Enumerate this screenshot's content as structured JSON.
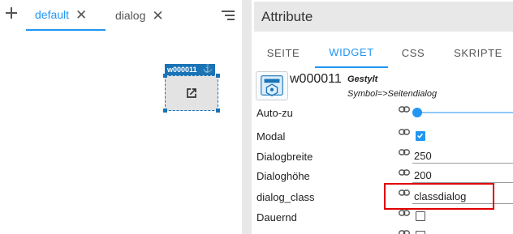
{
  "editor": {
    "tabs": [
      {
        "label": "default"
      },
      {
        "label": "dialog"
      }
    ],
    "widget": {
      "id_label": "w000011"
    }
  },
  "panel": {
    "title": "Attribute",
    "tabs": [
      {
        "label": "SEITE"
      },
      {
        "label": "WIDGET"
      },
      {
        "label": "CSS"
      },
      {
        "label": "SKRIPTE"
      }
    ],
    "active_tab": "WIDGET",
    "widget_id": "w000011",
    "styled": "Gestylt",
    "symbol": "Symbol=>Seitendialog",
    "rows": [
      {
        "label": "Auto-zu",
        "slider_level": 0
      },
      {
        "label": "Modal",
        "checked": true
      },
      {
        "label": "Dialogbreite",
        "value": "250"
      },
      {
        "label": "Dialoghöhe",
        "value": "200"
      },
      {
        "label": "dialog_class",
        "value": "classdialog"
      },
      {
        "label": "Dauernd",
        "checked": false
      }
    ]
  },
  "colors": {
    "accent": "#2196f3",
    "widget_blue": "#1a73b6",
    "highlight": "#e00000"
  }
}
